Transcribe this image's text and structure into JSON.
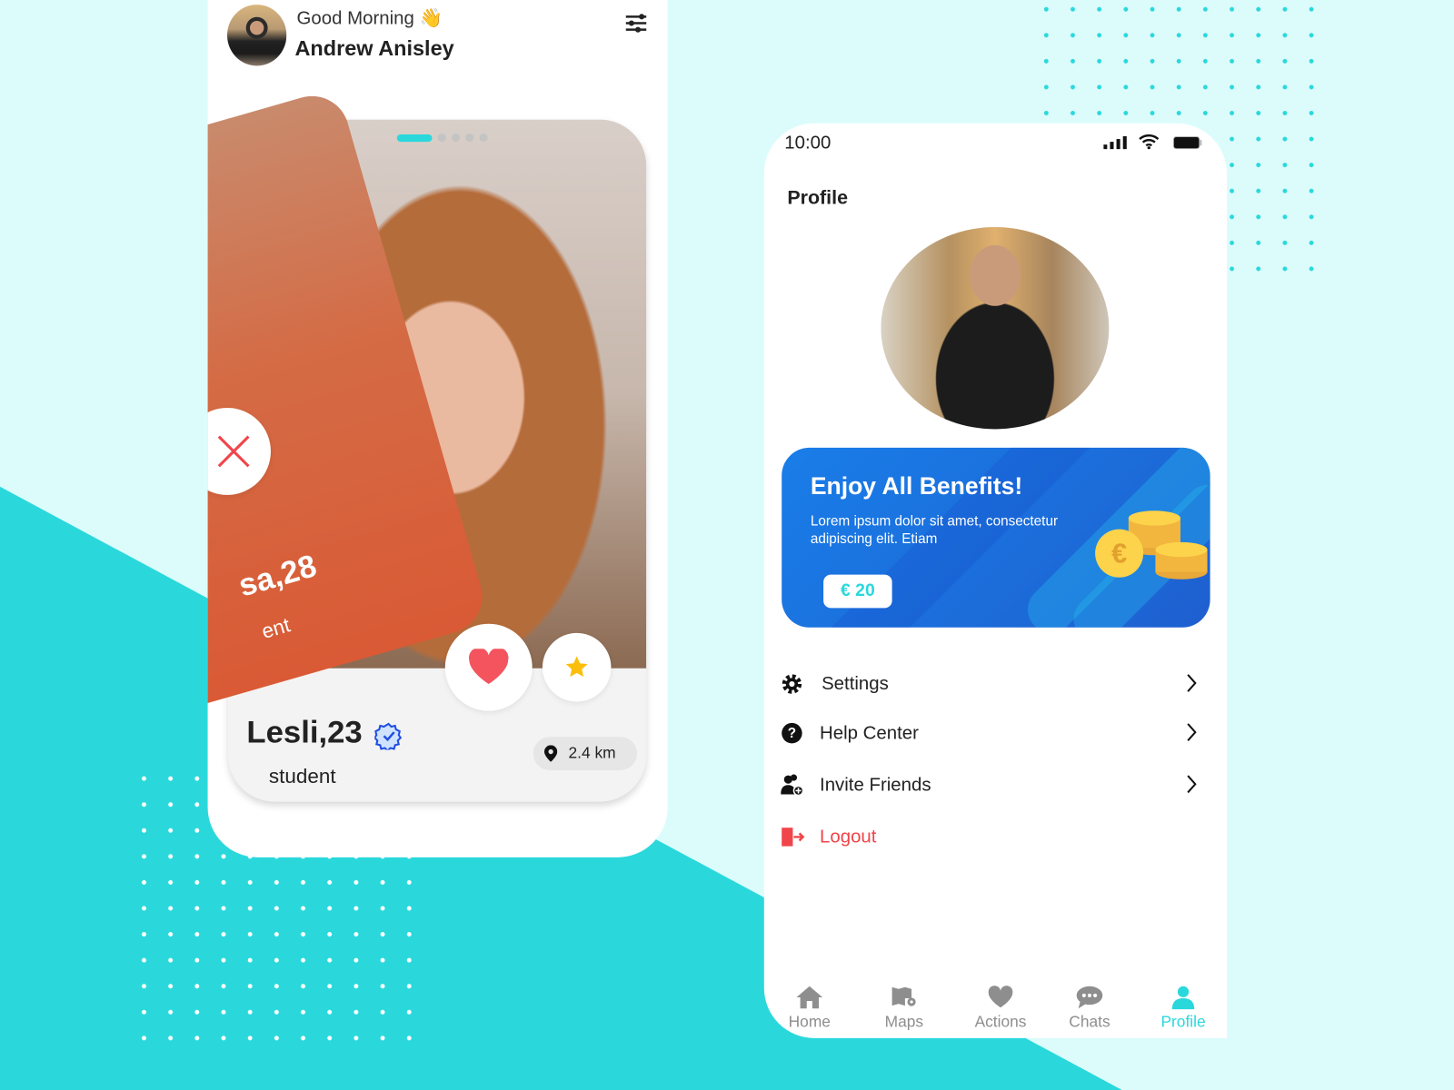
{
  "colors": {
    "accent": "#2ad8dc",
    "background": "#dcfcfc",
    "danger": "#f0454a",
    "star": "#fbbf0b",
    "card_blue": "#1b6fdc"
  },
  "home_screen": {
    "greeting": "Good Morning",
    "greeting_emoji": "👋",
    "user_name": "Andrew Anisley",
    "filter_icon": "sliders-icon",
    "carousel": {
      "total_pages": 5,
      "active_page": 1
    },
    "back_card": {
      "name_age": "sa,28",
      "occupation": "ent"
    },
    "front_card": {
      "name_age": "Lesli,23",
      "verified": true,
      "occupation": "student",
      "distance": "2.4 km"
    },
    "actions": [
      "dislike",
      "like",
      "super-like"
    ]
  },
  "profile_screen": {
    "status_bar": {
      "time": "10:00"
    },
    "title": "Profile",
    "benefits": {
      "title": "Enjoy All Benefits!",
      "body": "Lorem ipsum dolor sit amet, consectetur adipiscing elit. Etiam",
      "price": "€ 20"
    },
    "menu": [
      {
        "label": "Settings",
        "icon": "gear-icon"
      },
      {
        "label": "Help Center",
        "icon": "question-icon"
      },
      {
        "label": "Invite Friends",
        "icon": "add-user-icon"
      },
      {
        "label": "Logout",
        "icon": "logout-icon"
      }
    ],
    "nav": [
      {
        "label": "Home",
        "icon": "home-icon",
        "active": false
      },
      {
        "label": "Maps",
        "icon": "map-icon",
        "active": false
      },
      {
        "label": "Actions",
        "icon": "heart-icon",
        "active": false
      },
      {
        "label": "Chats",
        "icon": "chat-icon",
        "active": false
      },
      {
        "label": "Profile",
        "icon": "user-icon",
        "active": true
      }
    ]
  }
}
